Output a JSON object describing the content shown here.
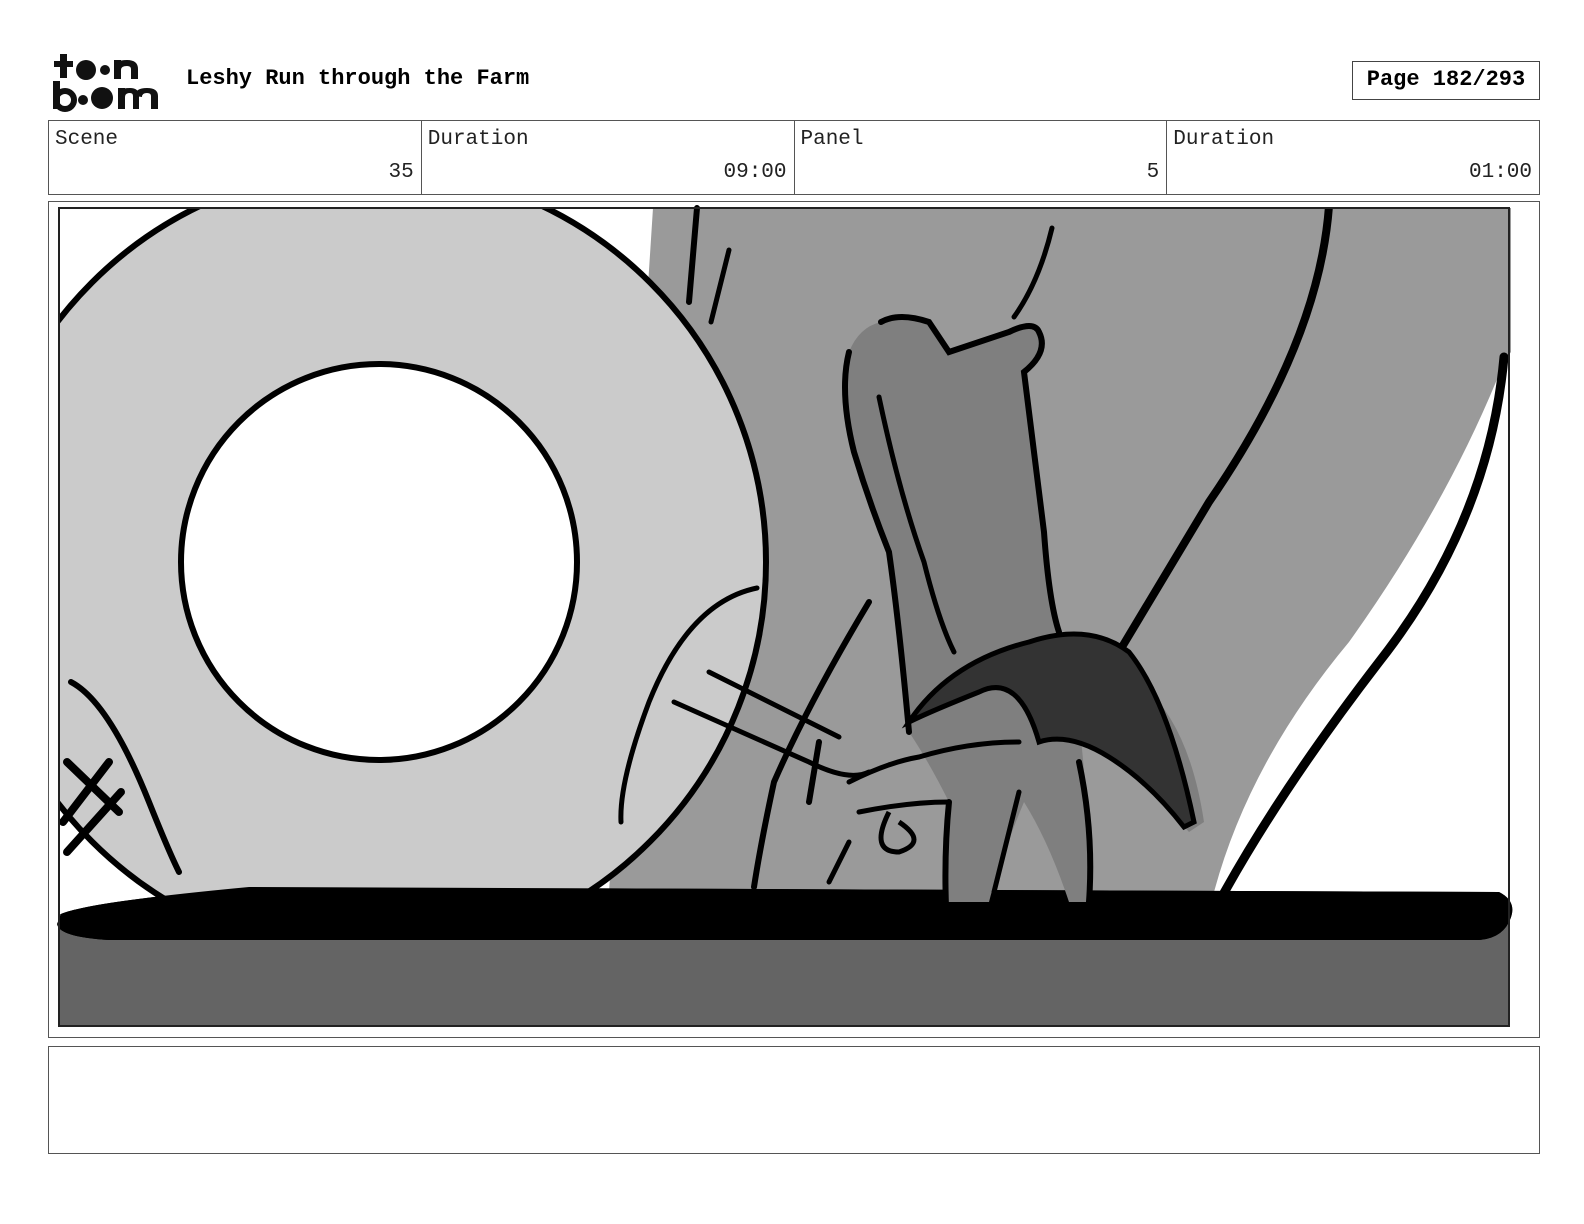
{
  "header": {
    "logo_text": "toon boom",
    "title": "Leshy Run through the Farm",
    "page_label": "Page 182/293"
  },
  "info": {
    "scene_label": "Scene",
    "scene_value": "35",
    "scene_duration_label": "Duration",
    "scene_duration_value": "09:00",
    "panel_label": "Panel",
    "panel_value": "5",
    "panel_duration_label": "Duration",
    "panel_duration_value": "01:00"
  },
  "notes": {
    "text": ""
  }
}
